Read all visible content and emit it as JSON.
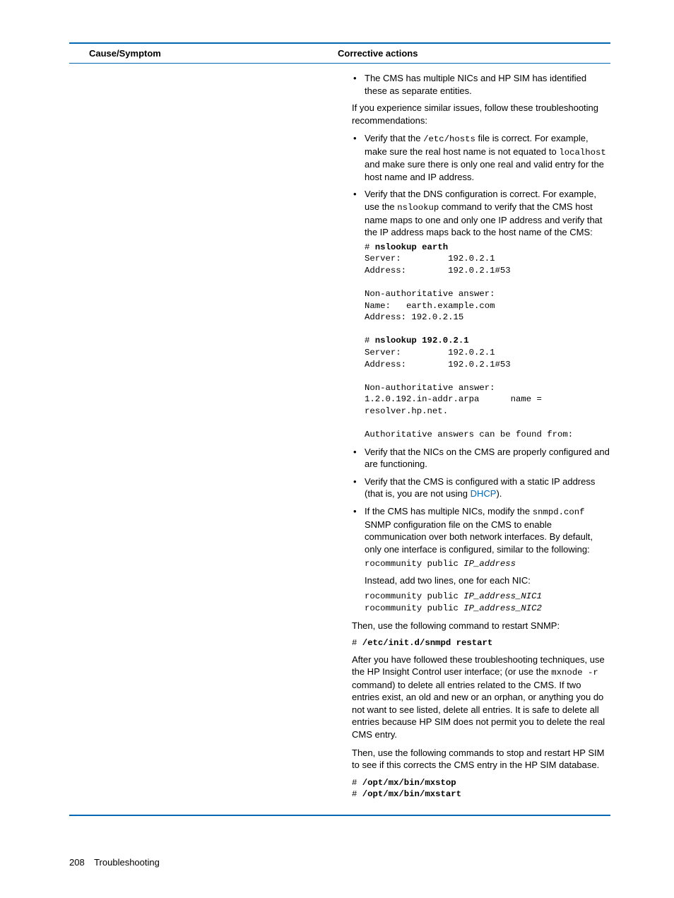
{
  "header": {
    "left": "Cause/Symptom",
    "right": "Corrective actions"
  },
  "b1": "The CMS has multiple NICs and HP SIM has identified these as separate entities.",
  "p1": "If you experience similar issues, follow these troubleshooting recommendations:",
  "b2a": "Verify that the ",
  "b2code1": "/etc/hosts",
  "b2b": " file is correct. For example, make sure the real host name is not equated to ",
  "b2code2": "localhost",
  "b2c": " and make sure there is only one real and valid entry for the host name and IP address.",
  "b3a": "Verify that the DNS configuration is correct. For example, use the ",
  "b3code": "nslookup",
  "b3b": " command to verify that the CMS host name maps to one and only one IP address and verify that the IP address maps back to the host name of the CMS:",
  "codeblock1": "# nslookup earth\nServer:         192.0.2.1\nAddress:        192.0.2.1#53\n\nNon-authoritative answer:\nName:   earth.example.com\nAddress: 192.0.2.15\n\n# nslookup 192.0.2.1\nServer:         192.0.2.1\nAddress:        192.0.2.1#53\n\nNon-authoritative answer:\n1.2.0.192.in-addr.arpa      name = \nresolver.hp.net.\n\nAuthoritative answers can be found from:",
  "codeline1": "nslookup earth",
  "codeline2": "nslookup 192.0.2.1",
  "b4": "Verify that the NICs on the CMS are properly configured and are functioning.",
  "b5a": "Verify that the CMS is configured with a static IP address (that is, you are not using ",
  "b5link": "DHCP",
  "b5b": ").",
  "b6a": "If the CMS has multiple NICs, modify the ",
  "b6code": "snmpd.conf",
  "b6b": " SNMP configuration file on the CMS to enable communication over both network interfaces. By default, only one interface is configured, similar to the following:",
  "b6c1": "rocommunity public ",
  "b6c1i": "IP_address",
  "b6p": "Instead, add two lines, one for each NIC:",
  "b6c2a": "rocommunity public ",
  "b6c2ai": "IP_address_NIC1",
  "b6c2b": "rocommunity public ",
  "b6c2bi": "IP_address_NIC2",
  "p2": "Then, use the following command to restart SNMP:",
  "code2": "# ",
  "code2b": "/etc/init.d/snmpd restart",
  "p3a": "After you have followed these troubleshooting techniques, use the HP Insight Control user interface; (or use the ",
  "p3code": "mxnode -r",
  "p3b": " command) to delete all entries related to the CMS. If two entries exist, an old and new or an orphan, or anything you do not want to see listed, delete all entries. It is safe to delete all entries because HP SIM does not permit you to delete the real CMS entry.",
  "p4": "Then, use the following commands to stop and restart HP SIM to see if this corrects the CMS entry in the HP SIM database.",
  "code3a": "# ",
  "code3ab": "/opt/mx/bin/mxstop",
  "code3b": "# ",
  "code3bb": "/opt/mx/bin/mxstart",
  "footer": {
    "page": "208",
    "section": "Troubleshooting"
  }
}
